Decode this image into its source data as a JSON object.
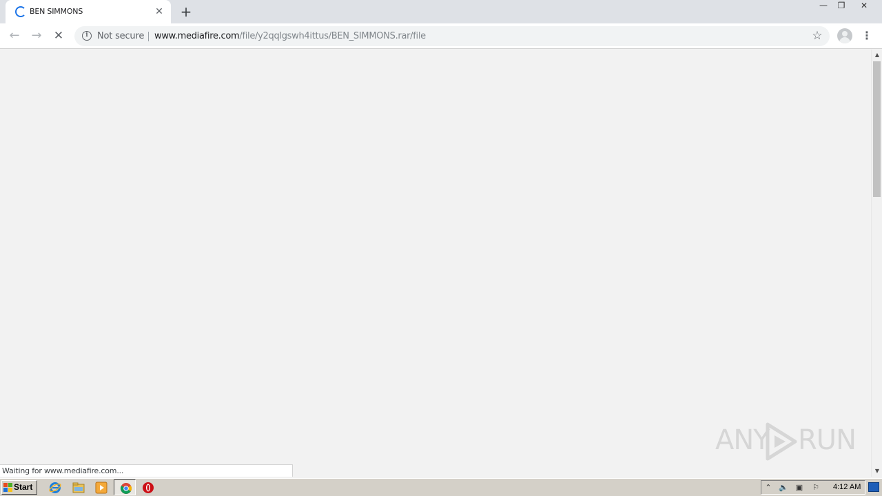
{
  "browser": {
    "tab": {
      "title": "BEN SIMMONS",
      "close_glyph": "✕",
      "new_tab_glyph": "+"
    },
    "window_controls": {
      "minimize": "—",
      "maximize": "❐",
      "close": "✕"
    },
    "toolbar": {
      "back_glyph": "←",
      "forward_glyph": "→",
      "stop_glyph": "✕",
      "security_label": "Not secure",
      "url_host": "www.mediafire.com",
      "url_path": "/file/y2qqlgswh4ittus/BEN_SIMMONS.rar/file",
      "star_glyph": "☆",
      "menu_glyph": "⋮"
    },
    "status_text": "Waiting for www.mediafire.com..."
  },
  "watermark": {
    "left": "ANY",
    "right": "RUN"
  },
  "taskbar": {
    "start_label": "Start",
    "apps": [
      "internet-explorer",
      "windows-explorer",
      "media-player",
      "chrome",
      "opera"
    ],
    "clock": "4:12 AM"
  },
  "colors": {
    "tabstrip": "#dee1e6",
    "content_bg": "#f2f2f2",
    "spinner": "#1a73e8",
    "taskbar": "#d4d0c8"
  }
}
